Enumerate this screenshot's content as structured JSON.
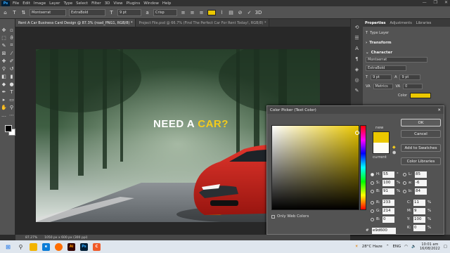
{
  "menubar": {
    "logo": "Ps",
    "items": [
      "File",
      "Edit",
      "Image",
      "Layer",
      "Type",
      "Select",
      "Filter",
      "3D",
      "View",
      "Plugins",
      "Window",
      "Help"
    ],
    "window_controls": [
      "—",
      "❐",
      "✕"
    ]
  },
  "options": {
    "font_family": "Montserrat",
    "font_style": "ExtraBold",
    "font_size": "9 pt",
    "aa": "Crisp",
    "text_color": "#ebc800"
  },
  "tabs": [
    {
      "label": "Rent A Car Business Card Design @ 87.3% (road_PNG1, RGB/8) *"
    },
    {
      "label": "Project File.psd @ 66.7% (Find The Perfect Car For Rent Today!, RGB/8) *"
    }
  ],
  "canvas": {
    "headline_1": "NEED A ",
    "headline_2": "CAR?"
  },
  "status": {
    "zoom": "87.27%",
    "doc": "1050 px x 600 px (300 ppi)"
  },
  "properties": {
    "tab_properties": "Properties",
    "tab_adjustments": "Adjustments",
    "tab_libraries": "Libraries",
    "type_layer": "Type Layer",
    "transform": "Transform",
    "character": "Character",
    "font_family": "Montserrat",
    "font_style": "ExtraBold",
    "font_size": "9 pt",
    "leading": "9 pt",
    "kerning": "Metrics",
    "tracking": "0",
    "color_label": "Color",
    "color": "#ebc800"
  },
  "picker": {
    "title": "Color Picker (Text Color)",
    "close": "✕",
    "new_label": "new",
    "current_label": "current",
    "new_color": "#ebc800",
    "current_color": "#fdfdf6",
    "ok": "OK",
    "cancel": "Cancel",
    "add_swatches": "Add to Swatches",
    "libraries": "Color Libraries",
    "only_web": "Only Web Colors",
    "H": "55",
    "S": "100",
    "B": "91",
    "R": "233",
    "G": "214",
    "Bv": "0",
    "L": "85",
    "a": "-6",
    "b": "84",
    "C": "11",
    "M": "9",
    "Y": "100",
    "K": "0",
    "hex": "e9d600",
    "deg": "°",
    "pct": "%"
  },
  "taskbar": {
    "weather": "28°C  Haze",
    "lang": "ENG",
    "time": "10:01 am",
    "date": "16/08/2022"
  }
}
